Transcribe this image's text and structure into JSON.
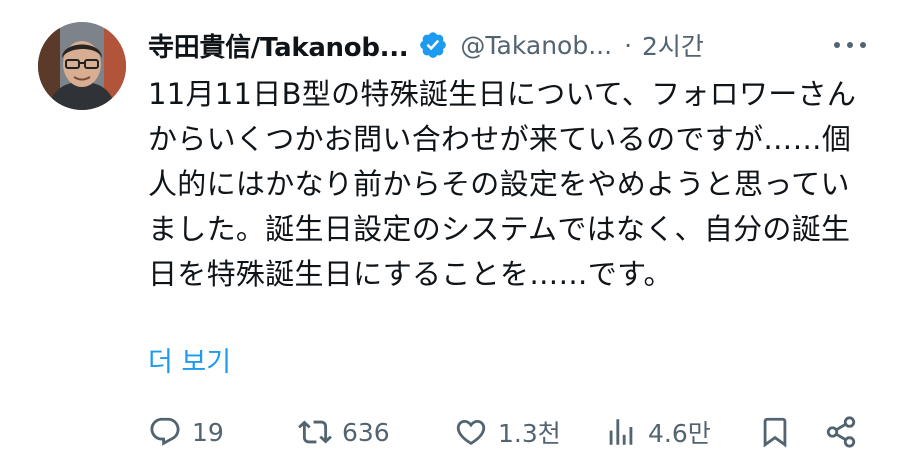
{
  "author": {
    "display_name": "寺田貴信/Takanob...",
    "handle": "@Takanob...",
    "separator": "·",
    "time": "2시간",
    "verified": true
  },
  "tweet": {
    "text": "11月11日B型の特殊誕生日について、フォロワーさんからいくつかお問い合わせが来ているのですが……個人的にはかなり前からその設定をやめようと思っていました。誕生日設定のシステムではなく、自分の誕生日を特殊誕生日にすることを……です。",
    "show_more": "더 보기"
  },
  "actions": {
    "replies": "19",
    "reposts": "636",
    "likes": "1.3천",
    "views": "4.6만"
  },
  "icons": [
    "more-icon",
    "verified-badge-icon",
    "reply-icon",
    "repost-icon",
    "like-icon",
    "views-icon",
    "bookmark-icon",
    "share-icon"
  ],
  "colors": {
    "text": "#0f1419",
    "secondary": "#536471",
    "accent": "#1d9bf0"
  }
}
